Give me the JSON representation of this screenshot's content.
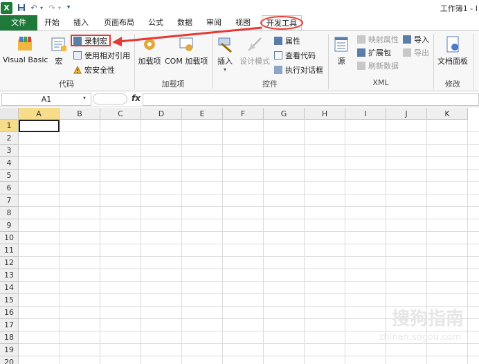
{
  "window": {
    "title": "工作簿1 - I"
  },
  "tabs": {
    "file": "文件",
    "home": "开始",
    "insert": "插入",
    "page_layout": "页面布局",
    "formulas": "公式",
    "data": "数据",
    "review": "审阅",
    "view": "视图",
    "developer": "开发工具"
  },
  "ribbon": {
    "code": {
      "label": "代码",
      "visual_basic": "Visual Basic",
      "macros": "宏",
      "record_macro": "录制宏",
      "relative_ref": "使用相对引用",
      "macro_security": "宏安全性"
    },
    "addins": {
      "label": "加载项",
      "addins": "加载项",
      "com_addins": "COM 加载项"
    },
    "controls": {
      "label": "控件",
      "insert": "插入",
      "design_mode": "设计模式",
      "properties": "属性",
      "view_code": "查看代码",
      "run_dialog": "执行对话框"
    },
    "xml": {
      "label": "XML",
      "source": "源",
      "map_properties": "映射属性",
      "expansion_packs": "扩展包",
      "refresh_data": "刷新数据",
      "import": "导入",
      "export": "导出"
    },
    "modify": {
      "label": "修改",
      "document_panel": "文档面板"
    }
  },
  "formula_bar": {
    "name_box": "A1",
    "fx": "fx",
    "value": ""
  },
  "grid": {
    "columns": [
      "A",
      "B",
      "C",
      "D",
      "E",
      "F",
      "G",
      "H",
      "I",
      "J",
      "K"
    ],
    "rows": [
      "1",
      "2",
      "3",
      "4",
      "5",
      "6",
      "7",
      "8",
      "9",
      "10",
      "11",
      "12",
      "13",
      "14",
      "15",
      "16",
      "17",
      "18",
      "19",
      "20"
    ],
    "active_cell": "A1"
  },
  "watermark": {
    "text": "搜狗指南",
    "sub": "zhinan.sogou.com"
  },
  "colors": {
    "excel_green": "#1f7a3a",
    "highlight_red": "#e53935",
    "selected_header": "#f7dc8a"
  }
}
